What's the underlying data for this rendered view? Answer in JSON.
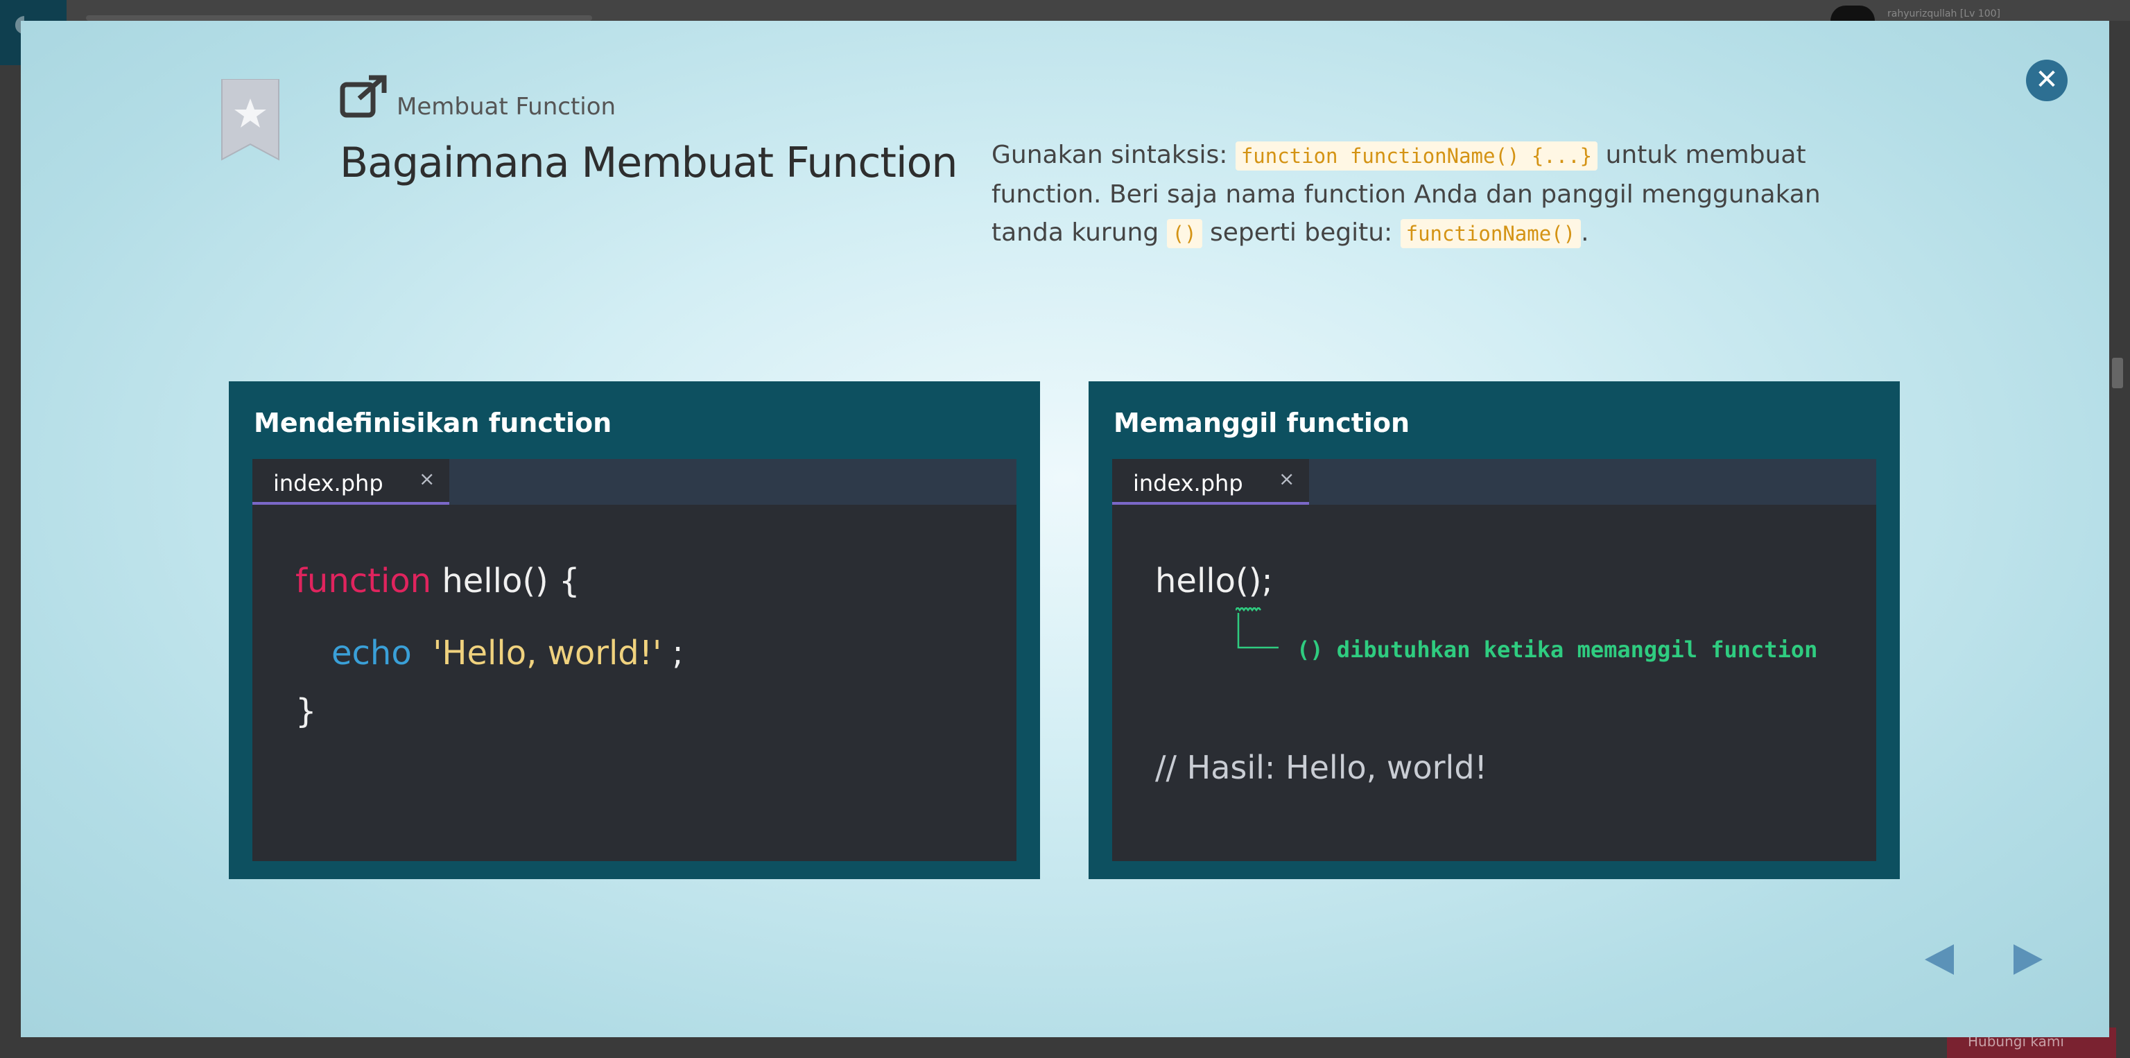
{
  "background": {
    "user_label": "rahyurizqullah [Lv 100]",
    "bottom_button_label": "Hubungi kami"
  },
  "lesson": {
    "bookmark_icon": "star-bookmark-icon",
    "subtitle_icon": "external-link-icon",
    "subtitle": "Membuat Function",
    "title": "Bagaimana Membuat Function",
    "description": {
      "part1": "Gunakan sintaksis: ",
      "code1": "function functionName() {...}",
      "part2": " untuk membuat function. Beri saja nama function Anda dan panggil menggunakan tanda kurung ",
      "code2": "()",
      "part3": " seperti begitu: ",
      "code3": "functionName()",
      "part4": "."
    }
  },
  "panels": {
    "left": {
      "title": "Mendefinisikan function",
      "tab": "index.php",
      "tab_close": "×",
      "code": {
        "keyword_function": "function",
        "fn_signature": " hello() {",
        "keyword_echo": "echo",
        "string": "'Hello, world!'",
        "semicolon": " ;",
        "close_brace": "}"
      }
    },
    "right": {
      "title": "Memanggil function",
      "tab": "index.php",
      "tab_close": "×",
      "code": {
        "call": "hello();",
        "annotation": "() dibutuhkan ketika memanggil function",
        "comment": "// Hasil: Hello, world!"
      }
    }
  },
  "colors": {
    "panel_bg": "#0d5060",
    "editor_bg": "#2a2d33",
    "tab_accent": "#7b68c8",
    "keyword_pink": "#e0245e",
    "keyword_blue": "#3aa0d8",
    "string_yellow": "#f0d27e",
    "annotation_green": "#2fcc80",
    "inline_code": "#d49314",
    "close_button": "#2d6f92",
    "nav_arrow": "#5b92b8"
  },
  "navigation": {
    "prev_icon": "triangle-left-icon",
    "next_icon": "triangle-right-icon",
    "close_icon": "close-icon"
  }
}
